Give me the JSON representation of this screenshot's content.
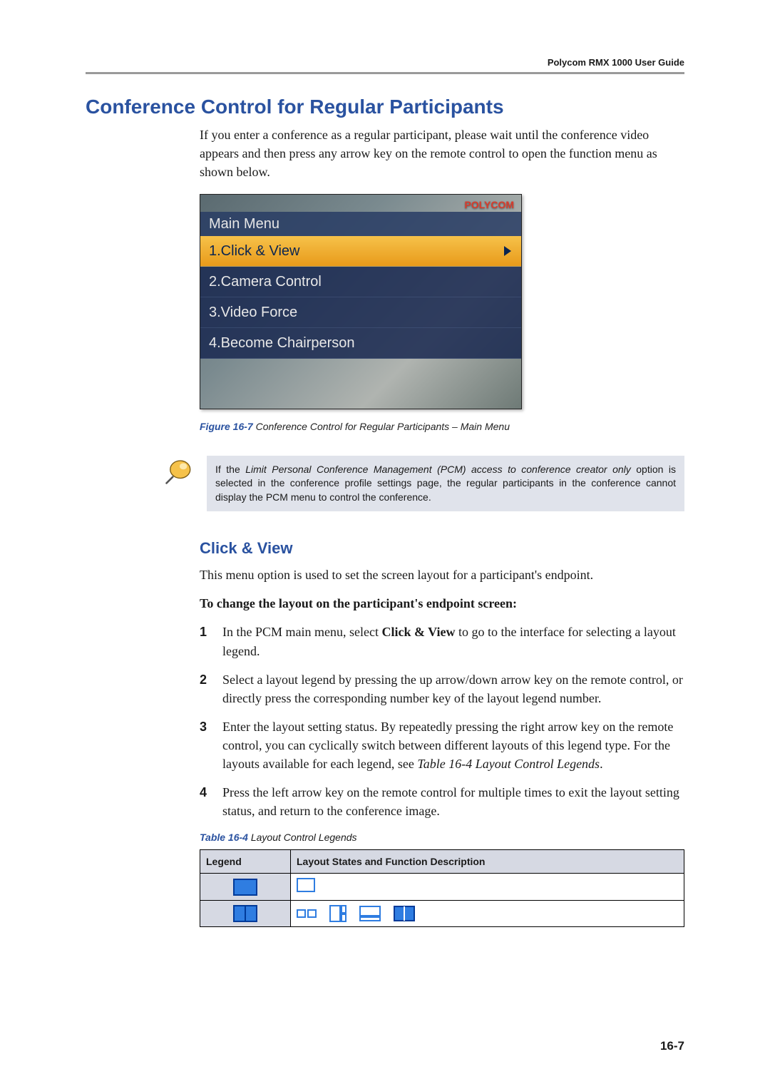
{
  "running_head": "Polycom RMX 1000 User Guide",
  "section_title": "Conference Control for Regular Participants",
  "intro_para": "If you enter a conference as a regular participant, please wait until the conference video appears and then press any arrow key on the remote control to open the function menu as shown below.",
  "shot": {
    "logo": "POLYCOM",
    "menu_title": "Main Menu",
    "items": [
      "1.Click & View",
      "2.Camera Control",
      "3.Video Force",
      "4.Become Chairperson"
    ]
  },
  "figure": {
    "label": "Figure 16-7",
    "text": " Conference Control for Regular Participants  – Main Menu"
  },
  "note": {
    "prefix": "If the ",
    "italic": "Limit Personal Conference Management (PCM) access to conference creator only",
    "suffix": " option is selected in the conference profile settings page, the regular participants in the conference cannot display the PCM menu to control the conference."
  },
  "sub_title": "Click & View",
  "steps_intro": "This menu option is used to set the screen layout for a participant's endpoint.",
  "steps_head": "To change the layout on the participant's endpoint screen:",
  "steps": [
    {
      "n": "1",
      "before": "In the PCM main menu, select ",
      "bold": "Click & View",
      "after": " to go to the interface for selecting a layout legend."
    },
    {
      "n": "2",
      "before": "Select a layout legend by pressing the up arrow/down arrow key on the remote control, or directly press the corresponding number key of the layout legend number.",
      "bold": "",
      "after": ""
    },
    {
      "n": "3",
      "before": "Enter the layout setting status. By repeatedly pressing the right arrow key on the remote control, you can cyclically switch between different layouts of this legend type. For the layouts available for each legend, see ",
      "bold": "",
      "after": "",
      "italic": "Table 16-4 Layout Control Legends",
      "tail": "."
    },
    {
      "n": "4",
      "before": "Press the left arrow key on the remote control for multiple times to exit the layout setting status, and return to the conference image.",
      "bold": "",
      "after": ""
    }
  ],
  "table_caption": {
    "label": "Table 16-4",
    "text": " Layout Control Legends"
  },
  "table_headers": {
    "c1": "Legend",
    "c2": "Layout States and Function Description"
  },
  "page_num": "16-7"
}
